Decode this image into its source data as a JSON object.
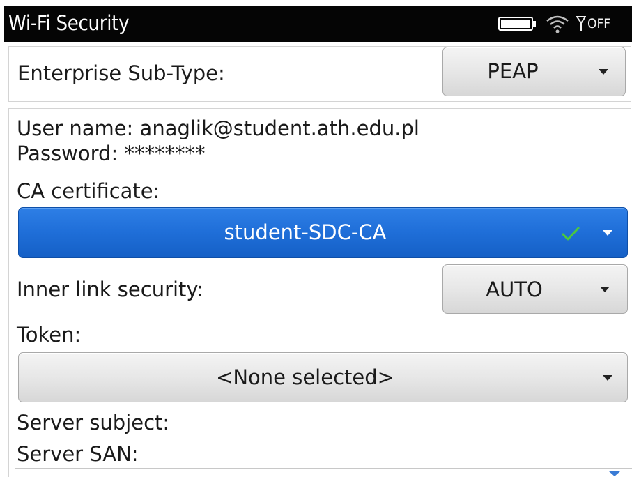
{
  "header": {
    "title": "Wi-Fi Security",
    "status": {
      "battery_icon": "battery-icon",
      "wifi_icon": "wifi-icon",
      "antenna_icon": "antenna-icon",
      "radio_label": "OFF"
    }
  },
  "enterprise": {
    "label": "Enterprise Sub-Type:",
    "value": "PEAP"
  },
  "credentials": {
    "username_line": "User name: anaglik@student.ath.edu.pl",
    "password_line": "Password: ********",
    "ca_label": "CA certificate:",
    "ca_value": "student-SDC-CA"
  },
  "inner": {
    "label": "Inner link security:",
    "value": "AUTO"
  },
  "token": {
    "label": "Token:",
    "value": "<None selected>"
  },
  "server": {
    "subject_label": "Server subject:",
    "san_label": "Server SAN:"
  },
  "colors": {
    "titlebar_bg": "#050505",
    "selected_dropdown": "#1f6ed8",
    "check_mark": "#4cc93c",
    "dropdown_bg": "#e7e7e7"
  }
}
